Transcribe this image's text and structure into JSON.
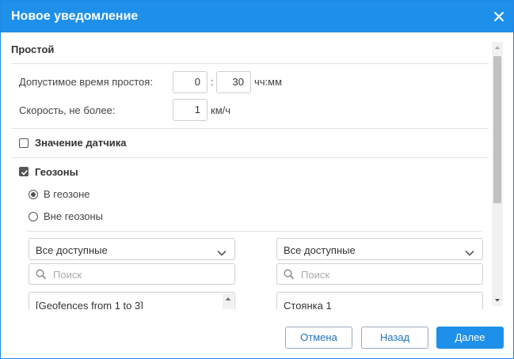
{
  "dialog": {
    "title": "Новое уведомление",
    "close_icon": "close-icon"
  },
  "section": {
    "title": "Простой"
  },
  "idle": {
    "time_label": "Допустимое время простоя:",
    "hours_value": "0",
    "separator": ":",
    "minutes_value": "30",
    "time_unit": "чч:мм",
    "speed_label": "Скорость, не более:",
    "speed_value": "1",
    "speed_unit": "км/ч"
  },
  "sensor": {
    "label": "Значение датчика",
    "checked": false
  },
  "geofences": {
    "label": "Геозоны",
    "checked": true,
    "radio_in": "В геозоне",
    "radio_out": "Вне геозоны",
    "selected": "В геозоне",
    "left": {
      "select_value": "Все доступные",
      "search_placeholder": "Поиск",
      "list_item": "[Geofences from 1 to 3]"
    },
    "right": {
      "select_value": "Все доступные",
      "search_placeholder": "Поиск",
      "list_item": "Стоянка 1"
    }
  },
  "footer": {
    "cancel_label": "Отмена",
    "back_label": "Назад",
    "next_label": "Далее"
  },
  "colors": {
    "accent": "#1e90ea",
    "secondary_text": "#1e73be"
  }
}
